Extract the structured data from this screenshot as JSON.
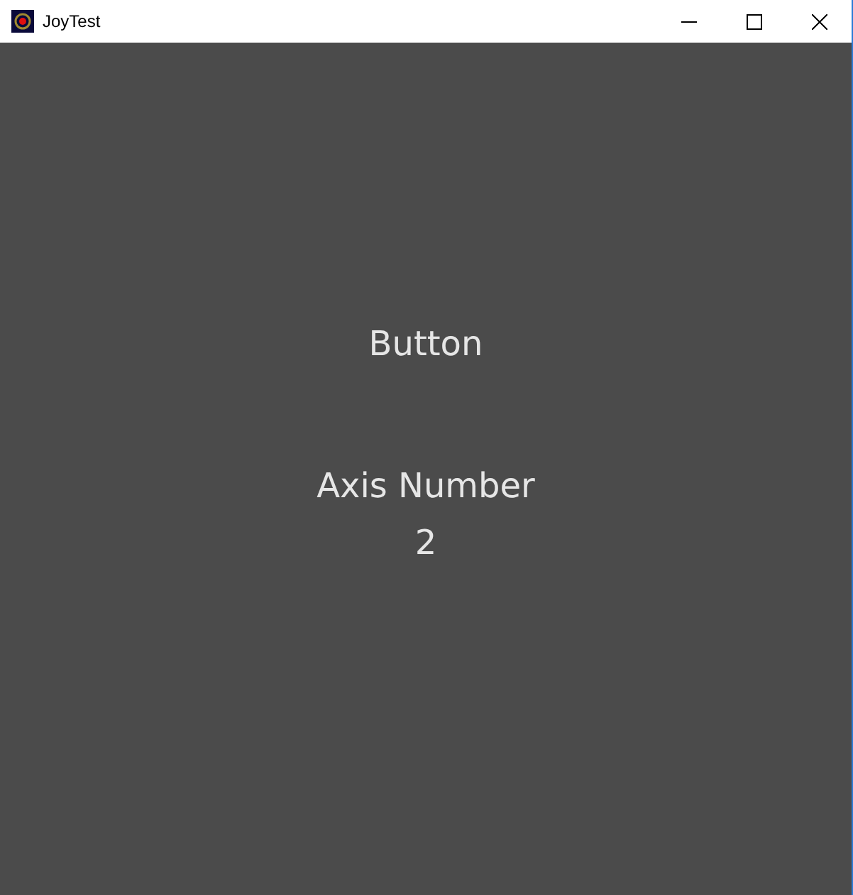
{
  "window": {
    "title": "JoyTest"
  },
  "content": {
    "button_label": "Button",
    "axis_label": "Axis Number",
    "axis_value": "2"
  }
}
